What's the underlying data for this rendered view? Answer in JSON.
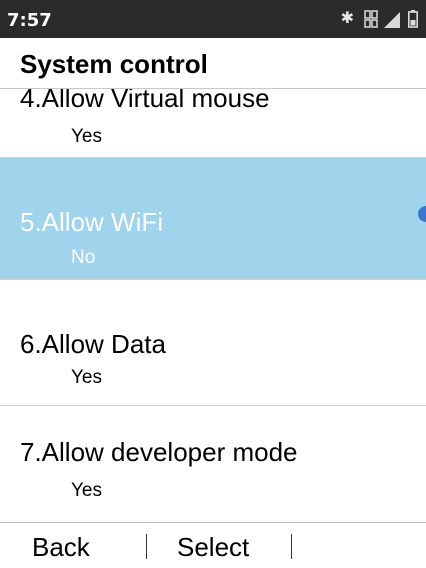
{
  "status_bar": {
    "time": "7:57",
    "icons": [
      "bluetooth-icon",
      "dual-sim-icon",
      "signal-icon",
      "battery-icon"
    ]
  },
  "header": {
    "title": "System control"
  },
  "items": [
    {
      "title": "4.Allow Virtual mouse",
      "value": "Yes",
      "selected": false
    },
    {
      "title": "5.Allow WiFi",
      "value": "No",
      "selected": true
    },
    {
      "title": "6.Allow Data",
      "value": "Yes",
      "selected": false
    },
    {
      "title": "7.Allow developer mode",
      "value": "Yes",
      "selected": false
    }
  ],
  "softkeys": {
    "left": "Back",
    "center": "Select"
  },
  "colors": {
    "status_bar": "#2b2b2b",
    "selected_row": "#9fd4ec",
    "scroll_indicator": "#3a78c9"
  }
}
